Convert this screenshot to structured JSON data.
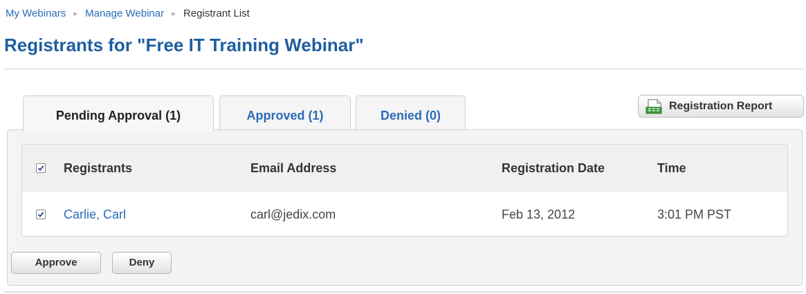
{
  "breadcrumb": {
    "items": [
      "My Webinars",
      "Manage Webinar"
    ],
    "current": "Registrant List"
  },
  "page": {
    "title": "Registrants for \"Free IT Training Webinar\""
  },
  "tabs": [
    {
      "label": "Pending Approval (1)",
      "active": true
    },
    {
      "label": "Approved (1)",
      "active": false
    },
    {
      "label": "Denied (0)",
      "active": false
    }
  ],
  "report_button": {
    "label": "Registration Report",
    "icon": "spreadsheet-icon"
  },
  "table": {
    "columns": [
      "Registrants",
      "Email Address",
      "Registration Date",
      "Time"
    ],
    "select_all_checked": true,
    "rows": [
      {
        "checked": true,
        "name": "Carlie, Carl",
        "email": "carl@jedix.com",
        "date": "Feb 13, 2012",
        "time": "3:01 PM PST"
      }
    ]
  },
  "actions": {
    "approve": "Approve",
    "deny": "Deny"
  },
  "colors": {
    "link": "#2a6cb5",
    "title": "#1f5e9e"
  }
}
